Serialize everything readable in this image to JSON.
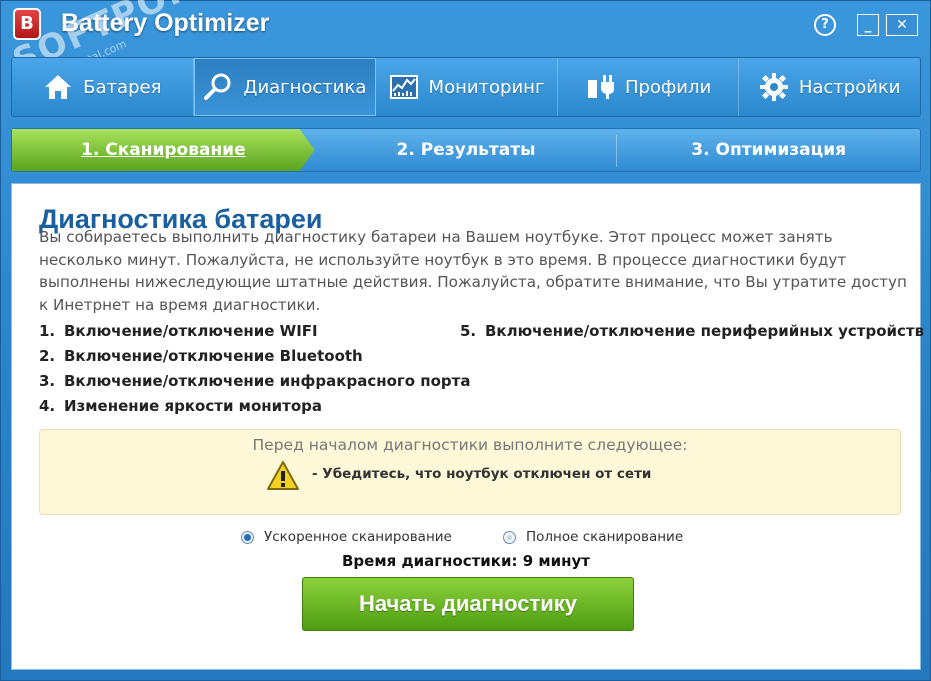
{
  "app": {
    "logo_letter": "B",
    "title": "Battery Optimizer",
    "help_label": "?",
    "minimize_label": "_",
    "close_label": "✕",
    "watermark": "SOFTPORTAL",
    "watermark_url": "www.softportal.com"
  },
  "nav": {
    "tabs": [
      {
        "label": "Батарея",
        "icon": "home-icon"
      },
      {
        "label": "Диагностика",
        "icon": "magnifier-icon"
      },
      {
        "label": "Мониторинг",
        "icon": "chart-monitor-icon"
      },
      {
        "label": "Профили",
        "icon": "plug-icon"
      },
      {
        "label": "Настройки",
        "icon": "gear-icon"
      }
    ],
    "active": "Диагностика"
  },
  "steps": [
    {
      "label": "1. Сканирование"
    },
    {
      "label": "2. Результаты"
    },
    {
      "label": "3. Оптимизация"
    }
  ],
  "main": {
    "title": "Диагностика батареи",
    "intro": "Вы собираетесь выполнить диагностику батареи на Вашем ноутбуке. Этот процесс может занять несколько минут. Пожалуйста, не используйте ноутбук в это время. В процессе диагностики будут выполнены нижеследующие штатные действия. Пожалуйста, обратите внимание, что Вы утратите доступ к Инетрнет на время диагностики.",
    "actions_left": [
      {
        "num": "1.",
        "text": "Включение/отключение WIFI"
      },
      {
        "num": "2.",
        "text": "Включение/отключение Bluetooth"
      },
      {
        "num": "3.",
        "text": "Включение/отключение инфракрасного порта"
      },
      {
        "num": "4.",
        "text": "Изменение яркости монитора"
      }
    ],
    "actions_right": [
      {
        "num": "5.",
        "text": "Включение/отключение периферийных устройств"
      }
    ],
    "notice_title": "Перед началом диагностики выполните следующее:",
    "notice_item": "- Убедитесь, что ноутбук отключен от сети",
    "radio_quick": "Ускоренное сканирование",
    "radio_full": "Полное сканирование",
    "duration": "Время диагностики: 9 минут",
    "start_button": "Начать диагностику"
  },
  "colors": {
    "accent": "#2a83c9",
    "green": "#5ba31f",
    "title_blue": "#1a5f9e"
  }
}
